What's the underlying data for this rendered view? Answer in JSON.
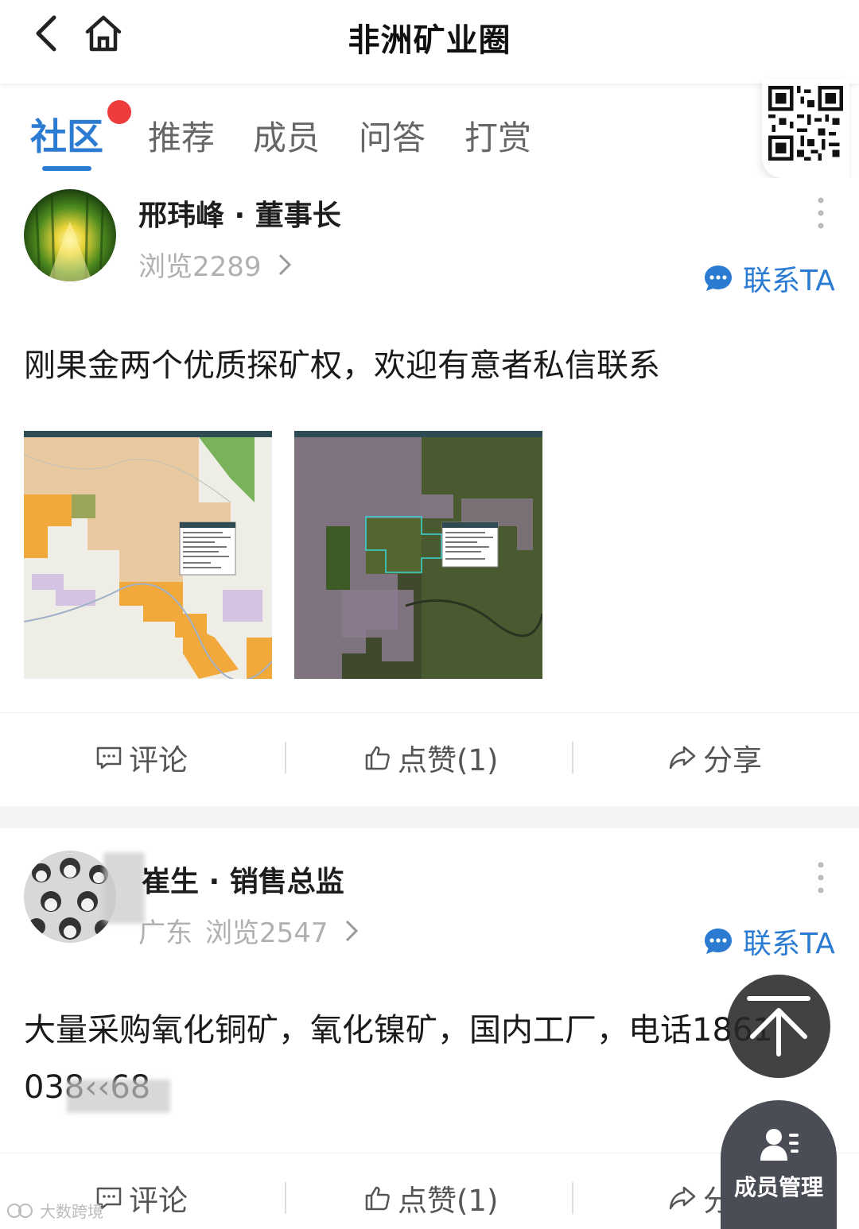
{
  "header": {
    "title": "非洲矿业圈"
  },
  "tabs": [
    {
      "label": "社区",
      "active": true,
      "has_dot": true
    },
    {
      "label": "推荐"
    },
    {
      "label": "成员"
    },
    {
      "label": "问答"
    },
    {
      "label": "打赏"
    }
  ],
  "posts": [
    {
      "author": "邢玮峰 · 董事长",
      "location": "",
      "views": "浏览2289",
      "contact_label": "联系TA",
      "text": "刚果金两个优质探矿权，欢迎有意者私信联系",
      "actions": {
        "comment": "评论",
        "like": "点赞(1)",
        "share": "分享"
      }
    },
    {
      "author": "崔生 · 销售总监",
      "location": "广东",
      "views": "浏览2547",
      "contact_label": "联系TA",
      "text_line1": "大量采购氧化铜矿，氧化镍矿，国内工厂，电话1861",
      "text_line2": "038‹‹68",
      "actions": {
        "comment": "评论",
        "like": "点赞(1)",
        "share": "分享"
      }
    }
  ],
  "floating": {
    "member_manage_label": "成员管理"
  },
  "watermark": "大数跨境",
  "colors": {
    "accent": "#2b7bd3",
    "badge": "#ee3b3b",
    "fab": "#4a4d55"
  }
}
